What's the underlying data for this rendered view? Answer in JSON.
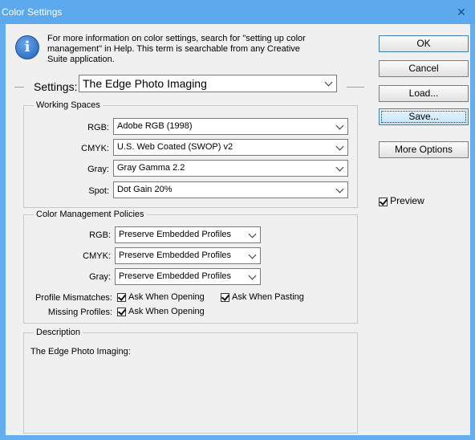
{
  "window": {
    "title": "Color Settings"
  },
  "info": {
    "text": "For more information on color settings, search for \"setting up color management\" in Help. This term is searchable from any Creative Suite application."
  },
  "buttons": {
    "ok": "OK",
    "cancel": "Cancel",
    "load": "Load...",
    "save": "Save...",
    "more_options": "More Options"
  },
  "preview": {
    "label": "Preview",
    "checked": true
  },
  "settings": {
    "label": "Settings:",
    "value": "The Edge Photo Imaging"
  },
  "working_spaces": {
    "title": "Working Spaces",
    "rows": [
      {
        "label": "RGB:",
        "value": "Adobe RGB (1998)"
      },
      {
        "label": "CMYK:",
        "value": "U.S. Web Coated (SWOP) v2"
      },
      {
        "label": "Gray:",
        "value": "Gray Gamma 2.2"
      },
      {
        "label": "Spot:",
        "value": "Dot Gain 20%"
      }
    ]
  },
  "policies": {
    "title": "Color Management Policies",
    "rows": [
      {
        "label": "RGB:",
        "value": "Preserve Embedded Profiles"
      },
      {
        "label": "CMYK:",
        "value": "Preserve Embedded Profiles"
      },
      {
        "label": "Gray:",
        "value": "Preserve Embedded Profiles"
      }
    ],
    "profile_mismatches": {
      "label": "Profile Mismatches:",
      "ask_opening": "Ask When Opening",
      "ask_pasting": "Ask When Pasting"
    },
    "missing_profiles": {
      "label": "Missing Profiles:",
      "ask_opening": "Ask When Opening"
    }
  },
  "description": {
    "title": "Description",
    "text": "The Edge Photo Imaging:"
  }
}
